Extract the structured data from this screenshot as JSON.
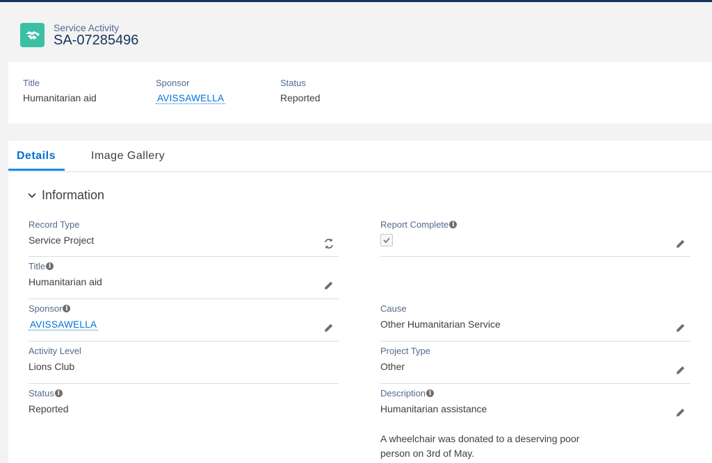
{
  "header": {
    "object_type": "Service Activity",
    "record_name": "SA-07285496",
    "icon": "handshake-icon"
  },
  "highlights": {
    "title_label": "Title",
    "title_value": "Humanitarian aid",
    "sponsor_label": "Sponsor",
    "sponsor_value": "AVISSAWELLA",
    "status_label": "Status",
    "status_value": "Reported"
  },
  "tabs": [
    {
      "label": "Details",
      "active": true
    },
    {
      "label": "Image Gallery",
      "active": false
    }
  ],
  "section": {
    "title": "Information"
  },
  "fields": {
    "record_type_label": "Record Type",
    "record_type_value": "Service Project",
    "report_complete_label": "Report Complete",
    "report_complete_checked": true,
    "title_label": "Title",
    "title_value": "Humanitarian aid",
    "sponsor_label": "Sponsor",
    "sponsor_value": "AVISSAWELLA",
    "cause_label": "Cause",
    "cause_value": "Other Humanitarian Service",
    "activity_level_label": "Activity Level",
    "activity_level_value": "Lions Club",
    "project_type_label": "Project Type",
    "project_type_value": "Other",
    "status_label": "Status",
    "status_value": "Reported",
    "description_label": "Description",
    "description_line1": "Humanitarian assistance",
    "description_line2": "A wheelchair was donated to a deserving poor",
    "description_line3": "person on 3rd of May."
  },
  "colors": {
    "accent": "#0070d2",
    "icon_bg": "#3bbfa5",
    "header_bar": "#16325c"
  }
}
